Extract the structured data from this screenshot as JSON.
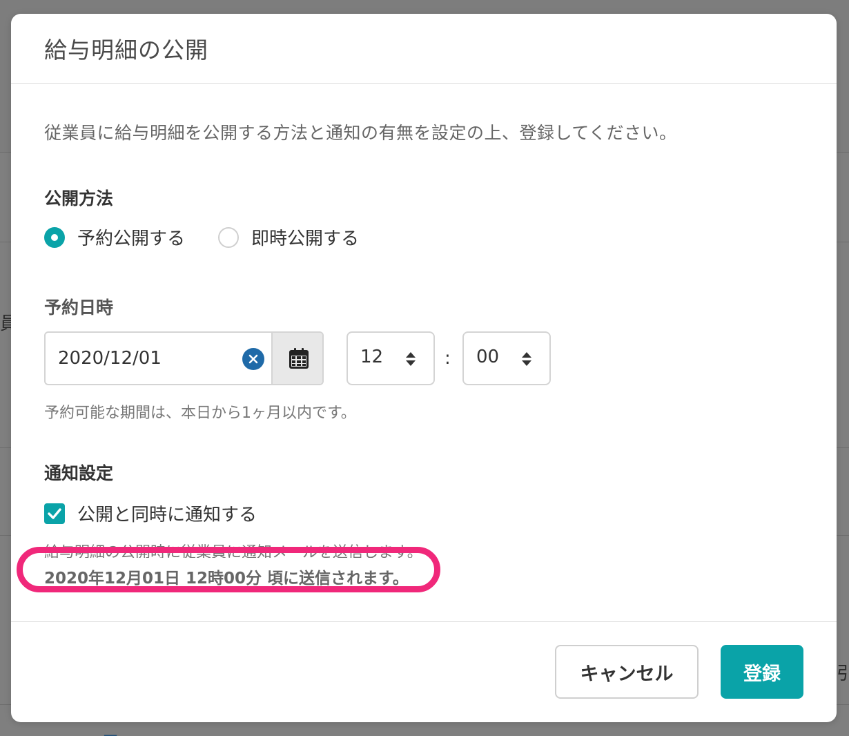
{
  "modal": {
    "title": "給与明細の公開",
    "description": "従業員に給与明細を公開する方法と通知の有無を設定の上、登録してください。"
  },
  "publish_method": {
    "label": "公開方法",
    "options": [
      {
        "label": "予約公開する",
        "selected": true
      },
      {
        "label": "即時公開する",
        "selected": false
      }
    ]
  },
  "schedule": {
    "label": "予約日時",
    "date_value": "2020/12/01",
    "hour_value": "12",
    "minute_value": "00",
    "separator": ":",
    "hint": "予約可能な期間は、本日から1ヶ月以内です。"
  },
  "notification": {
    "label": "通知設定",
    "checkbox_label": "公開と同時に通知する",
    "checked": true,
    "hint": "給与明細の公開時に従業員に通知メールを送信します。",
    "send_time": "2020年12月01日 12時00分 頃に送信されます。"
  },
  "footer": {
    "cancel_label": "キャンセル",
    "submit_label": "登録"
  },
  "colors": {
    "accent": "#0aa3a8",
    "clear_button": "#1f6aa8",
    "highlight": "#f0287a"
  },
  "icons": {
    "clear": "close-icon",
    "calendar": "calendar-icon",
    "spinner": "sort-icon",
    "check": "check-icon"
  }
}
